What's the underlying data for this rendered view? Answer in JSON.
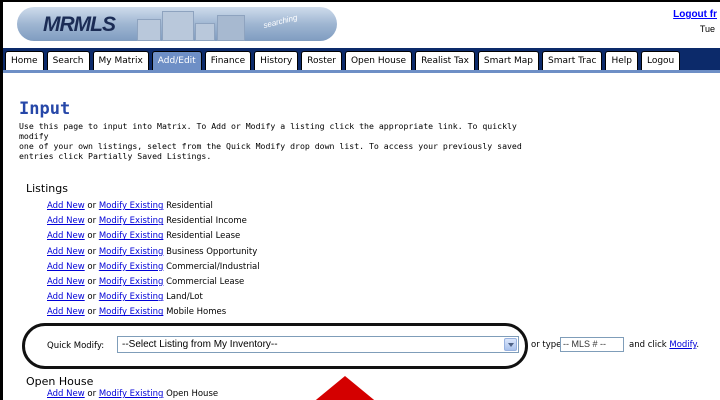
{
  "header": {
    "logo_text": "MRMLS",
    "tagline": "searching",
    "logout_label": "Logout fr",
    "date_text": "Tue"
  },
  "nav": {
    "tabs": [
      {
        "label": "Home"
      },
      {
        "label": "Search"
      },
      {
        "label": "My Matrix"
      },
      {
        "label": "Add/Edit",
        "active": true
      },
      {
        "label": "Finance"
      },
      {
        "label": "History"
      },
      {
        "label": "Roster"
      },
      {
        "label": "Open House"
      },
      {
        "label": "Realist Tax"
      },
      {
        "label": "Smart Map"
      },
      {
        "label": "Smart Trac"
      },
      {
        "label": "Help"
      },
      {
        "label": "Logou"
      }
    ]
  },
  "page": {
    "title": "Input",
    "intro_lines": [
      "Use this page to input into Matrix. To Add or Modify a listing click the appropriate link. To quickly modify",
      "one of your own listings, select from the Quick Modify drop down list. To access your previously saved",
      "entries click Partially Saved Listings."
    ]
  },
  "listings": {
    "title": "Listings",
    "add_label": "Add New",
    "or_text": " or ",
    "modify_label": "Modify Existing",
    "types": [
      "Residential",
      "Residential Income",
      "Residential Lease",
      "Business Opportunity",
      "Commercial/Industrial",
      "Commercial Lease",
      "Land/Lot",
      "Mobile Homes"
    ]
  },
  "quick_modify": {
    "label": "Quick Modify:",
    "selected_option": "--Select Listing from My Inventory--",
    "or_type_text": "or type",
    "mls_placeholder": "-- MLS # --",
    "and_click_text": "and click",
    "modify_link": "Modify",
    "period": "."
  },
  "open_house": {
    "title": "Open House",
    "add_label": "Add New",
    "or_text": " or ",
    "modify_label": "Modify Existing",
    "type": "Open House"
  },
  "annotation": {
    "oval_color": "#111111",
    "arrow_color": "#d40000"
  }
}
